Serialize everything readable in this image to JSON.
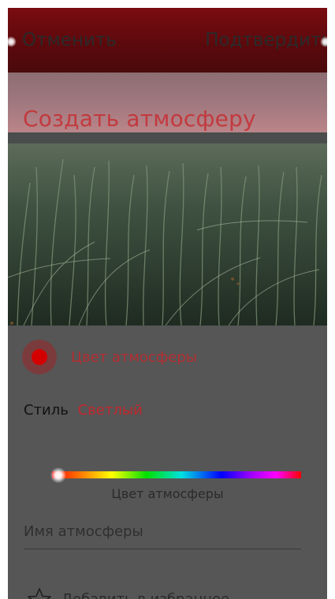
{
  "header": {
    "cancel_label": "Отменить",
    "confirm_label": "Подтвердить"
  },
  "hero": {
    "title": "Создать атмосферу"
  },
  "ambience_color": {
    "label": "Цвет атмосферы",
    "color": "#d40000"
  },
  "style": {
    "label": "Стиль",
    "value": "Светлый"
  },
  "color_slider": {
    "caption": "Цвет атмосферы"
  },
  "name_field": {
    "placeholder": "Имя атмосферы",
    "value": ""
  },
  "favorite": {
    "label": "Добавить в избранное",
    "icon": "star-outline-icon"
  },
  "colors": {
    "accent": "#c0272d",
    "header_bg": "#6a0b0e",
    "panel_bg": "#565656"
  }
}
